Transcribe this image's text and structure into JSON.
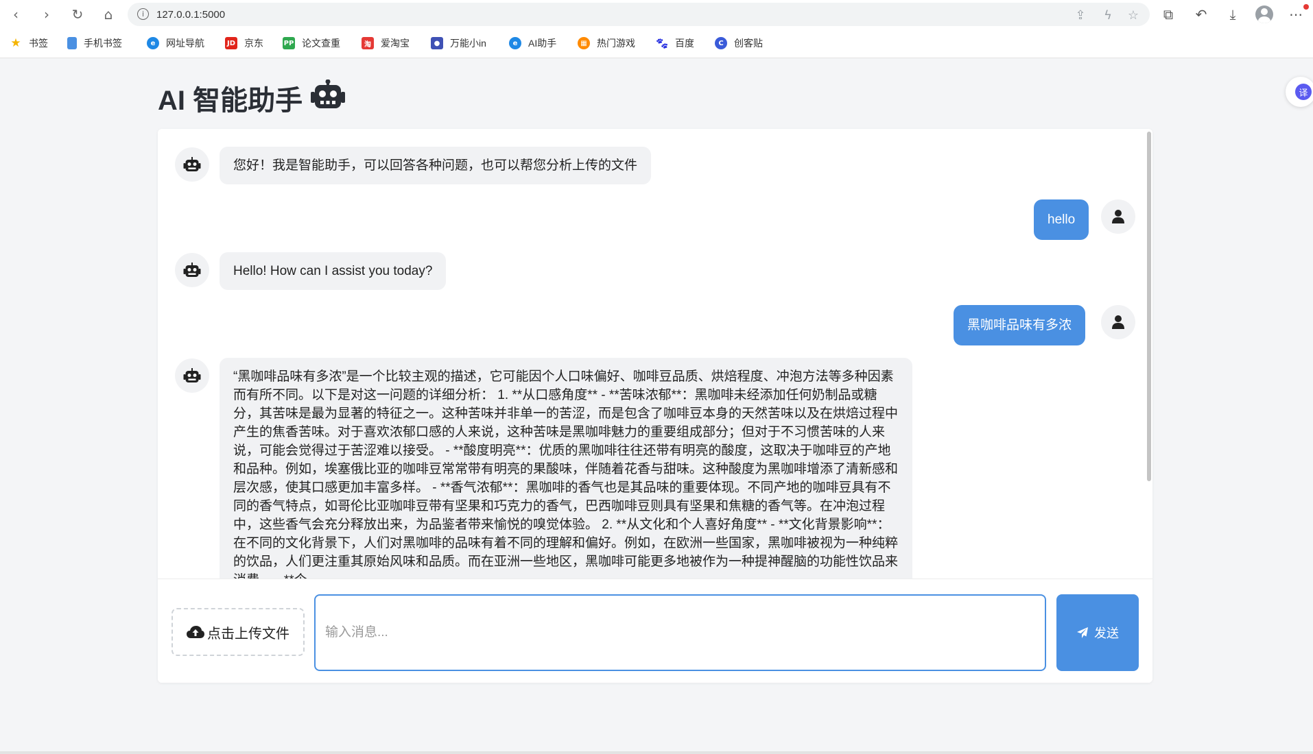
{
  "browser": {
    "url": "127.0.0.1:5000",
    "bookmarks": [
      {
        "label": "书签",
        "icon": "star-icon",
        "color": "#f5b400"
      },
      {
        "label": "手机书签",
        "icon": "phone-bookmark-icon",
        "color": "#4a90e2"
      },
      {
        "label": "网址导航",
        "icon": "ie-icon",
        "color": "#1e88e5"
      },
      {
        "label": "京东",
        "icon": "jd-icon",
        "color": "#e1251b"
      },
      {
        "label": "论文查重",
        "icon": "pp-icon",
        "color": "#2fa84f"
      },
      {
        "label": "爱淘宝",
        "icon": "taobao-icon",
        "color": "#e53935"
      },
      {
        "label": "万能小in",
        "icon": "robot-icon",
        "color": "#3f51b5"
      },
      {
        "label": "AI助手",
        "icon": "ai-icon",
        "color": "#1e88e5"
      },
      {
        "label": "热门游戏",
        "icon": "game-icon",
        "color": "#ff8a00"
      },
      {
        "label": "百度",
        "icon": "baidu-icon",
        "color": "#2932e1"
      },
      {
        "label": "创客贴",
        "icon": "chuangketie-icon",
        "color": "#3a5bd9"
      }
    ]
  },
  "page": {
    "title": "AI 智能助手"
  },
  "translate_badge": "译",
  "chat": {
    "messages": [
      {
        "role": "bot",
        "text": "您好！我是智能助手，可以回答各种问题，也可以帮您分析上传的文件"
      },
      {
        "role": "user",
        "text": "hello"
      },
      {
        "role": "bot",
        "text": "Hello! How can I assist you today?"
      },
      {
        "role": "user",
        "text": "黑咖啡品味有多浓"
      },
      {
        "role": "bot",
        "text": "“黑咖啡品味有多浓”是一个比较主观的描述，它可能因个人口味偏好、咖啡豆品质、烘焙程度、冲泡方法等多种因素而有所不同。以下是对这一问题的详细分析： 1. **从口感角度** - **苦味浓郁**：黑咖啡未经添加任何奶制品或糖分，其苦味是最为显著的特征之一。这种苦味并非单一的苦涩，而是包含了咖啡豆本身的天然苦味以及在烘焙过程中产生的焦香苦味。对于喜欢浓郁口感的人来说，这种苦味是黑咖啡魅力的重要组成部分；但对于不习惯苦味的人来说，可能会觉得过于苦涩难以接受。 - **酸度明亮**：优质的黑咖啡往往还带有明亮的酸度，这取决于咖啡豆的产地和品种。例如，埃塞俄比亚的咖啡豆常常带有明亮的果酸味，伴随着花香与甜味。这种酸度为黑咖啡增添了清新感和层次感，使其口感更加丰富多样。 - **香气浓郁**：黑咖啡的香气也是其品味的重要体现。不同产地的咖啡豆具有不同的香气特点，如哥伦比亚咖啡豆带有坚果和巧克力的香气，巴西咖啡豆则具有坚果和焦糖的香气等。在冲泡过程中，这些香气会充分释放出来，为品鉴者带来愉悦的嗅觉体验。 2. **从文化和个人喜好角度** - **文化背景影响**：在不同的文化背景下，人们对黑咖啡的品味有着不同的理解和偏好。例如，在欧洲一些国家，黑咖啡被视为一种纯粹的饮品，人们更注重其原始风味和品质。而在亚洲一些地区，黑咖啡可能更多地被作为一种提神醒脑的功能性饮品来消费。 - **个"
      }
    ]
  },
  "composer": {
    "upload_label": "点击上传文件",
    "placeholder": "输入消息...",
    "send_label": "发送"
  }
}
